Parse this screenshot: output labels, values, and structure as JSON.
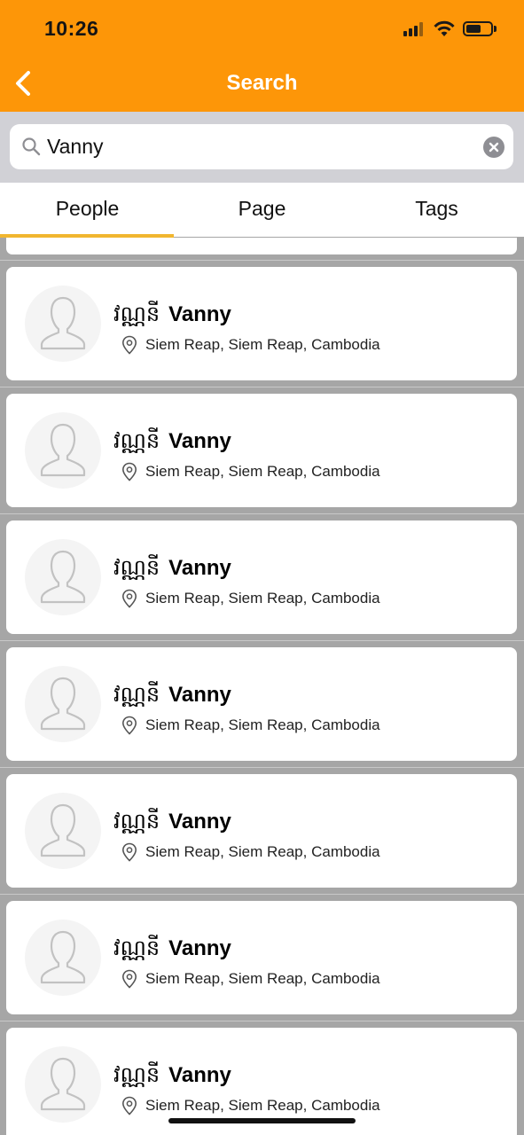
{
  "status_bar": {
    "time": "10:26"
  },
  "nav": {
    "title": "Search"
  },
  "search": {
    "value": "Vanny",
    "placeholder": ""
  },
  "tabs": [
    {
      "label": "People",
      "active": true
    },
    {
      "label": "Page",
      "active": false
    },
    {
      "label": "Tags",
      "active": false
    }
  ],
  "results": [
    {
      "khmer_name": "វណ្ណនី",
      "name": "Vanny",
      "location": "Siem Reap, Siem Reap, Cambodia"
    },
    {
      "khmer_name": "វណ្ណនី",
      "name": "Vanny",
      "location": "Siem Reap, Siem Reap, Cambodia"
    },
    {
      "khmer_name": "វណ្ណនី",
      "name": "Vanny",
      "location": "Siem Reap, Siem Reap, Cambodia"
    },
    {
      "khmer_name": "វណ្ណនី",
      "name": "Vanny",
      "location": "Siem Reap, Siem Reap, Cambodia"
    },
    {
      "khmer_name": "វណ្ណនី",
      "name": "Vanny",
      "location": "Siem Reap, Siem Reap, Cambodia"
    },
    {
      "khmer_name": "វណ្ណនី",
      "name": "Vanny",
      "location": "Siem Reap, Siem Reap, Cambodia"
    },
    {
      "khmer_name": "វណ្ណនី",
      "name": "Vanny",
      "location": "Siem Reap, Siem Reap, Cambodia"
    }
  ],
  "colors": {
    "header": "#fd9608",
    "tab_indicator": "#f1b62f",
    "list_background": "#a6a6a6"
  },
  "icons": {
    "back": "chevron-left-icon",
    "search": "search-icon",
    "clear": "clear-icon",
    "avatar": "person-placeholder-icon",
    "location": "location-pin-icon"
  }
}
